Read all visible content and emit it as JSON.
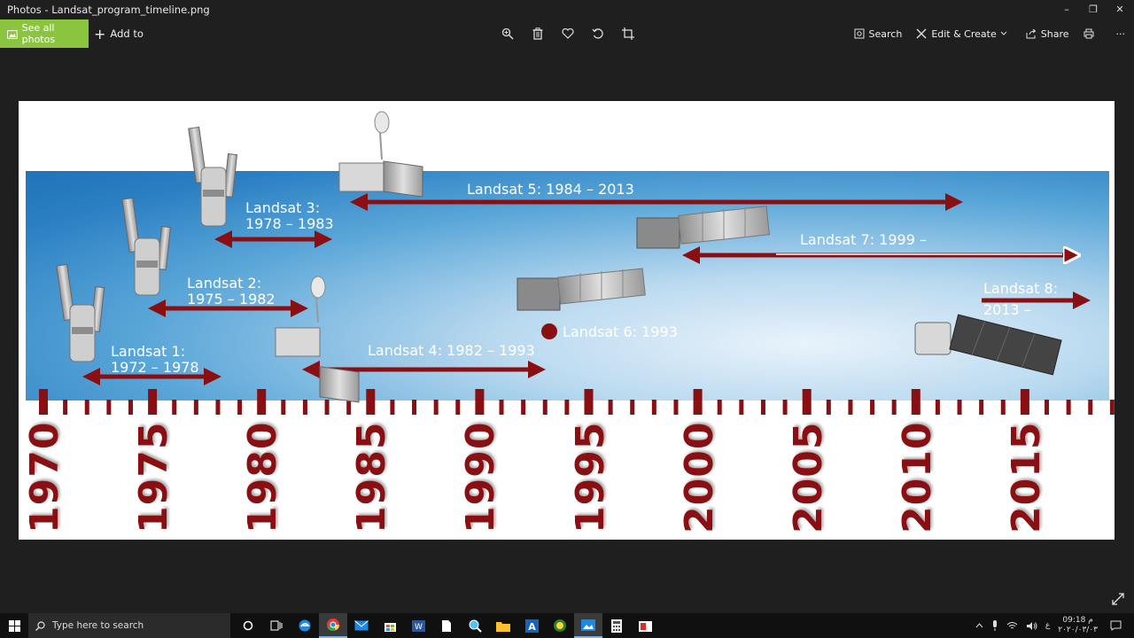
{
  "window": {
    "title": "Photos - Landsat_program_timeline.png",
    "controls": {
      "minimize": "–",
      "restore": "❐",
      "close": "✕"
    }
  },
  "toolbar": {
    "see_all_photos": "See all photos",
    "add_to": "Add to",
    "search": "Search",
    "edit_create": "Edit & Create",
    "share": "Share",
    "more": "···"
  },
  "timeline": {
    "colors": {
      "band": "#2a7fc3",
      "arrow": "#8a0f12",
      "ruler": "#8a0f12"
    },
    "years": [
      "1970",
      "1975",
      "1980",
      "1985",
      "1990",
      "1995",
      "2000",
      "2005",
      "2010",
      "2015"
    ],
    "labels": {
      "l1_name": "Landsat 1:",
      "l1_years": "1972 – 1978",
      "l2_name": "Landsat 2:",
      "l2_years": "1975 – 1982",
      "l3_name": "Landsat 3:",
      "l3_years": "1978 – 1983",
      "l4": "Landsat 4: 1982 – 1993",
      "l5": "Landsat 5: 1984 – 2013",
      "l6": "Landsat 6: 1993",
      "l7": "Landsat 7: 1999 –",
      "l8_name": "Landsat 8:",
      "l8_years": "2013 –"
    }
  },
  "taskbar": {
    "search_placeholder": "Type here to search",
    "time": "09:18 م",
    "date": "۲۰۲۰/۰۳/۰۳",
    "lang": "ع"
  }
}
